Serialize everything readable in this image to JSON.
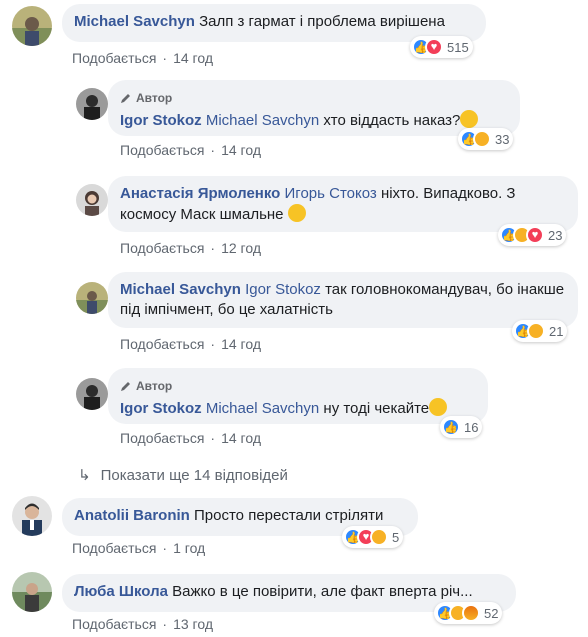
{
  "comments": [
    {
      "name": "Michael Savchyn",
      "text": "Залп з гармат і проблема вирішена",
      "like": "Подобається",
      "time": "14 год",
      "count": "515"
    },
    {
      "author_tag": "Автор",
      "name": "Igor Stokoz",
      "mention": "Michael Savchyn",
      "text": "хто віддасть наказ?",
      "like": "Подобається",
      "time": "14 год",
      "count": "33"
    },
    {
      "name": "Анастасія Ярмоленко",
      "mention": "Игорь Стокоз",
      "text": "ніхто. Випадково. З космосу Маск шмальне",
      "like": "Подобається",
      "time": "12 год",
      "count": "23"
    },
    {
      "name": "Michael Savchyn",
      "mention": "Igor Stokoz",
      "text": "так головнокомандувач, бо інакше під імпічмент, бо це халатність",
      "like": "Подобається",
      "time": "14 год",
      "count": "21"
    },
    {
      "author_tag": "Автор",
      "name": "Igor Stokoz",
      "mention": "Michael Savchyn",
      "text": "ну тоді чекайте",
      "like": "Подобається",
      "time": "14 год",
      "count": "16"
    },
    {
      "name": "Anatolii Baronin",
      "text": "Просто перестали стріляти",
      "like": "Подобається",
      "time": "1 год",
      "count": "5"
    },
    {
      "name": "Люба Школа",
      "text": "Важко в це повірити, але факт вперта річ...",
      "like": "Подобається",
      "time": "13 год",
      "count": "52"
    }
  ],
  "show_more": "Показати ще 14 відповідей",
  "icons": {
    "reply": "reply-arrow-icon",
    "author": "pencil-icon",
    "like": "like-icon",
    "love": "love-icon",
    "haha": "haha-icon",
    "sad": "sad-icon",
    "angry": "angry-icon"
  },
  "colors": {
    "name": "#385898",
    "bubble": "#f0f2f5",
    "meta": "#606770",
    "like": "#2d88ff",
    "love": "#f33e58"
  }
}
